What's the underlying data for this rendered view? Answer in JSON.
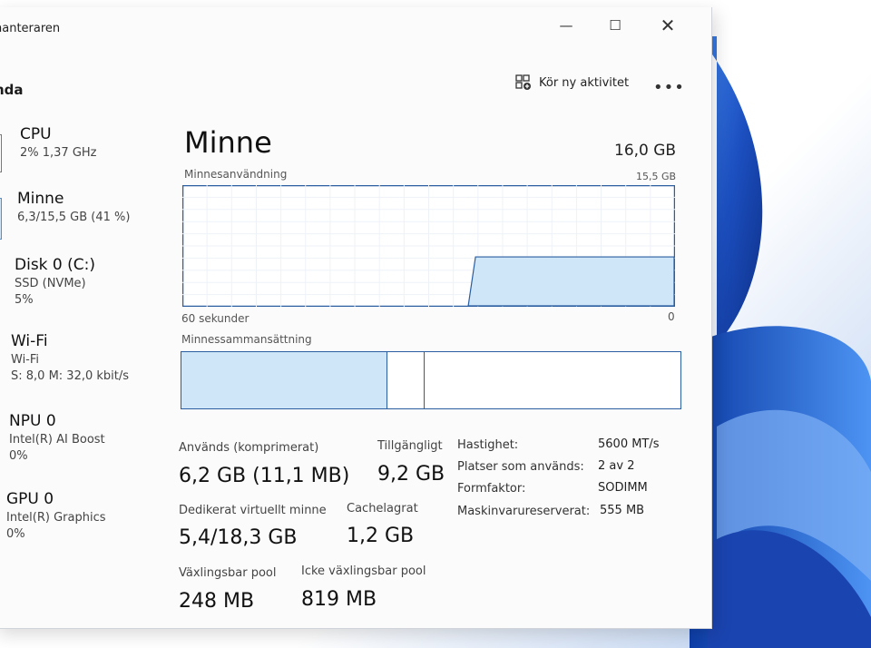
{
  "window": {
    "app_title": "hanteraren",
    "page_heading": "nda",
    "controls": {
      "minimize": "—",
      "maximize": "☐",
      "close": "✕"
    }
  },
  "toolbar": {
    "run_task_label": "Kör ny aktivitet",
    "more_label": "•••"
  },
  "sidebar": {
    "items": [
      {
        "name": "CPU",
        "lines": [
          "2%  1,37 GHz"
        ]
      },
      {
        "name": "Minne",
        "lines": [
          "6,3/15,5 GB (41 %)"
        ]
      },
      {
        "name": "Disk 0 (C:)",
        "lines": [
          "SSD (NVMe)",
          "5%"
        ]
      },
      {
        "name": "Wi-Fi",
        "lines": [
          "Wi-Fi",
          "S: 8,0  M: 32,0 kbit/s"
        ]
      },
      {
        "name": "NPU 0",
        "lines": [
          "Intel(R) AI Boost",
          "0%"
        ]
      },
      {
        "name": "GPU 0",
        "lines": [
          "Intel(R) Graphics",
          "0%"
        ]
      }
    ]
  },
  "main": {
    "title": "Minne",
    "total": "16,0 GB",
    "usage_chart_label": "Minnesanvändning",
    "usage_chart_max": "15,5 GB",
    "usage_x_left": "60 sekunder",
    "usage_x_right": "0",
    "usage_level": 0.41,
    "composition_label": "Minnessammansättning",
    "composition": {
      "in_use_fraction": 0.41,
      "modified_fraction": 0.075
    },
    "stats": [
      {
        "label": "Används (komprimerat)",
        "value": "6,2 GB (11,1 MB)"
      },
      {
        "label": "Tillgängligt",
        "value": "9,2 GB"
      },
      {
        "label": "Dedikerat virtuellt minne",
        "value": "5,4/18,3 GB"
      },
      {
        "label": "Cachelagrat",
        "value": "1,2 GB"
      },
      {
        "label": "Växlingsbar pool",
        "value": "248 MB"
      },
      {
        "label": "Icke växlingsbar pool",
        "value": "819 MB"
      }
    ],
    "properties": [
      {
        "label": "Hastighet:",
        "value": "5600 MT/s"
      },
      {
        "label": "Platser som används:",
        "value": "2 av 2"
      },
      {
        "label": "Formfaktor:",
        "value": "SODIMM"
      },
      {
        "label": "Maskinvarureserverat:",
        "value": "555 MB"
      }
    ]
  },
  "colors": {
    "accent": "#2a5ea0",
    "fill": "#cfe5f8",
    "wallpaper_blue": "#1f55c8"
  }
}
